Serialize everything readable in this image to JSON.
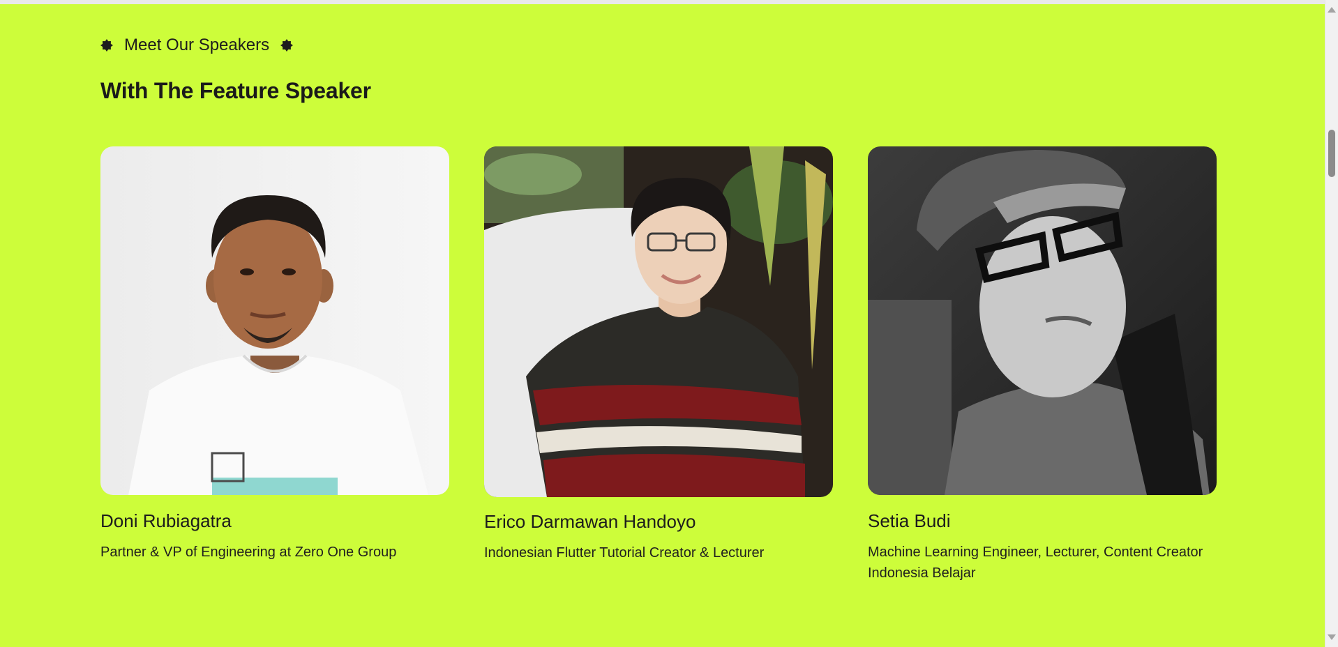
{
  "section": {
    "eyebrow": "Meet Our Speakers",
    "heading": "With The Feature Speaker"
  },
  "icons": {
    "eyebrow_left": "badge-icon",
    "eyebrow_right": "badge-icon"
  },
  "colors": {
    "background": "#cdfd3a",
    "text": "#1d1d1d"
  },
  "speakers": [
    {
      "name": "Doni Rubiagatra",
      "role": "Partner & VP of Engineering at Zero One Group",
      "photo_alt": "Doni Rubiagatra"
    },
    {
      "name": "Erico Darmawan Handoyo",
      "role": "Indonesian Flutter Tutorial Creator & Lecturer",
      "photo_alt": "Erico Darmawan Handoyo"
    },
    {
      "name": "Setia Budi",
      "role": "Machine Learning Engineer, Lecturer, Content Creator Indonesia Belajar",
      "photo_alt": "Setia Budi"
    }
  ]
}
